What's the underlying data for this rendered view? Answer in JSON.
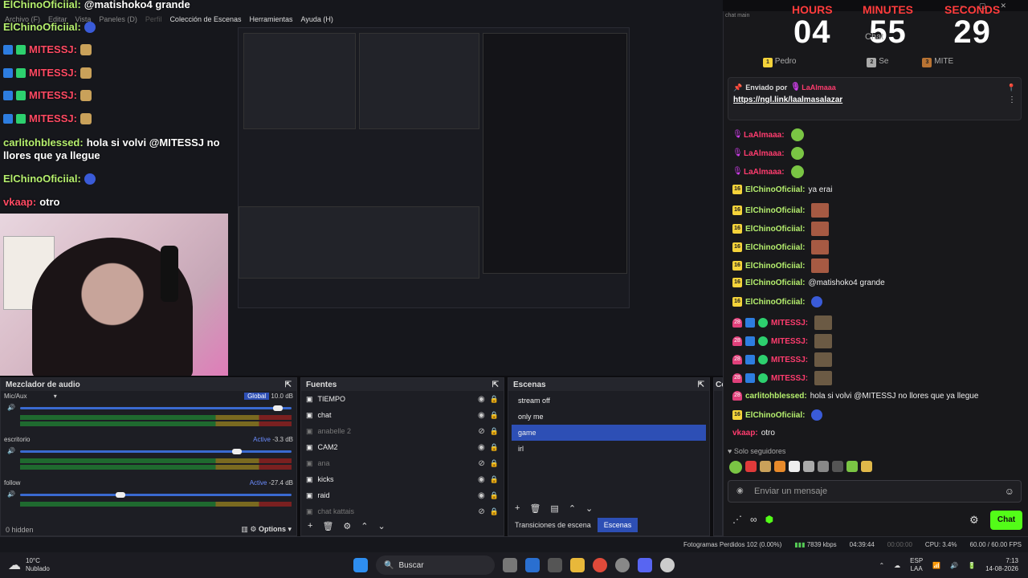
{
  "obs_menu": [
    "Archivo (F)",
    "Editar",
    "Vista",
    "Paneles (D)",
    "Perfil",
    "Colección de Escenas",
    "Herramientas",
    "Ayuda (H)"
  ],
  "overlay_chat": [
    {
      "name": "ElChinoOficiial:",
      "text": "@matishoko4 grande",
      "color": "green"
    },
    {
      "name": "ElChinoOficiial:",
      "text": "",
      "color": "green"
    },
    {
      "name": "MITESSJ:",
      "text": "",
      "color": "red"
    },
    {
      "name": "MITESSJ:",
      "text": "",
      "color": "red"
    },
    {
      "name": "MITESSJ:",
      "text": "",
      "color": "red"
    },
    {
      "name": "MITESSJ:",
      "text": "",
      "color": "red"
    },
    {
      "name": "carlitohblessed:",
      "text": "hola si volvi @MITESSJ no",
      "color": "green"
    },
    {
      "name": "",
      "text": "llores que ya llegue",
      "color": "white"
    },
    {
      "name": "ElChinoOficiial:",
      "text": "",
      "color": "green"
    },
    {
      "name": "vkaap:",
      "text": "otro",
      "color": "red"
    }
  ],
  "mixer": {
    "title": "Mezclador de audio",
    "tracks": [
      {
        "name": "Mic/Aux",
        "tag": "Global",
        "db": "10.0 dB",
        "level": 0.95
      },
      {
        "name": "escritorio",
        "tag": "Active",
        "db": "-3.3 dB",
        "level": 0.8
      },
      {
        "name": "follow",
        "tag": "Active",
        "db": "-27.4 dB",
        "level": 0.37
      }
    ],
    "scale": [
      "-60",
      "-54",
      "-48",
      "-42",
      "-36",
      "-30",
      "-24",
      "-18",
      "-12",
      "-6",
      "0"
    ],
    "hidden": "0 hidden",
    "options": "Options"
  },
  "sources": {
    "title": "Fuentes",
    "items": [
      {
        "label": "TIEMPO",
        "visible": true
      },
      {
        "label": "chat",
        "visible": true
      },
      {
        "label": "anabelle 2",
        "visible": false
      },
      {
        "label": "CAM2",
        "visible": true
      },
      {
        "label": "ana",
        "visible": false
      },
      {
        "label": "kicks",
        "visible": true
      },
      {
        "label": "raid",
        "visible": true
      },
      {
        "label": "chat kattais",
        "visible": false
      }
    ]
  },
  "scenes": {
    "title": "Escenas",
    "items": [
      "stream off",
      "only me",
      "game",
      "irl"
    ],
    "selected": 2,
    "tab_transitions": "Transiciones de escena",
    "tab_scenes": "Escenas",
    "next_panel": "Co"
  },
  "status": {
    "frames": "Fotogramas Perdidos 102 (0.00%)",
    "bitrate": "7839 kbps",
    "rec": "04:39:44",
    "time2": "00:00:00",
    "cpu": "CPU: 3.4%",
    "fps": "60.00 / 60.00 FPS"
  },
  "taskbar": {
    "weather_temp": "10°C",
    "weather_desc": "Nublado",
    "search": "Buscar",
    "lang": "ESP",
    "lang2": "LAA",
    "time": "7:13",
    "date": "14-08-2026"
  },
  "chat": {
    "window_title": "chat main",
    "timer": {
      "hours_label": "HOURS",
      "minutes_label": "MINUTES",
      "seconds_label": "SECONDS",
      "hours": "04",
      "minutes": "55",
      "seconds": "29"
    },
    "header": "Chat",
    "top_users": [
      "Pedro",
      "Se",
      "MITE"
    ],
    "pinned_by": "Enviado por",
    "pinned_user": "LaAlmaaa",
    "pinned_link": "https://ngl.link/laalmasalazar",
    "messages": [
      {
        "name": "LaAlmaaa:",
        "text": "",
        "badge": "mic",
        "color": "#ff3c6e"
      },
      {
        "name": "LaAlmaaa:",
        "text": "",
        "badge": "mic",
        "color": "#ff3c6e"
      },
      {
        "name": "LaAlmaaa:",
        "text": "",
        "badge": "mic",
        "color": "#ff3c6e"
      },
      {
        "name": "ElChinoOficiial:",
        "text": "ya erai",
        "badge": "16",
        "color": "#b6f06e"
      },
      {
        "name": "ElChinoOficiial:",
        "text": "",
        "badge": "16",
        "color": "#b6f06e"
      },
      {
        "name": "ElChinoOficiial:",
        "text": "",
        "badge": "16",
        "color": "#b6f06e"
      },
      {
        "name": "ElChinoOficiial:",
        "text": "",
        "badge": "16",
        "color": "#b6f06e"
      },
      {
        "name": "ElChinoOficiial:",
        "text": "",
        "badge": "16",
        "color": "#b6f06e"
      },
      {
        "name": "ElChinoOficiial:",
        "text": "@matishoko4 grande",
        "badge": "16",
        "color": "#b6f06e"
      },
      {
        "name": "ElChinoOficiial:",
        "text": "",
        "badge": "16",
        "color": "#b6f06e"
      },
      {
        "name": "MITESSJ:",
        "text": "",
        "badge": "28",
        "color": "#ff3c6e"
      },
      {
        "name": "MITESSJ:",
        "text": "",
        "badge": "28",
        "color": "#ff3c6e"
      },
      {
        "name": "MITESSJ:",
        "text": "",
        "badge": "28",
        "color": "#ff3c6e"
      },
      {
        "name": "MITESSJ:",
        "text": "",
        "badge": "28",
        "color": "#ff3c6e"
      },
      {
        "name": "carlitohblessed:",
        "text": "hola si volvi @MITESSJ no llores que ya llegue",
        "badge": "28",
        "color": "#b6f06e"
      },
      {
        "name": "ElChinoOficiial:",
        "text": "",
        "badge": "16",
        "color": "#b6f06e"
      },
      {
        "name": "vkaap:",
        "text": "otro",
        "badge": "",
        "color": "#ff3c6e"
      }
    ],
    "followers_only": "Solo seguidores",
    "input_placeholder": "Enviar un mensaje",
    "send_label": "Chat"
  }
}
